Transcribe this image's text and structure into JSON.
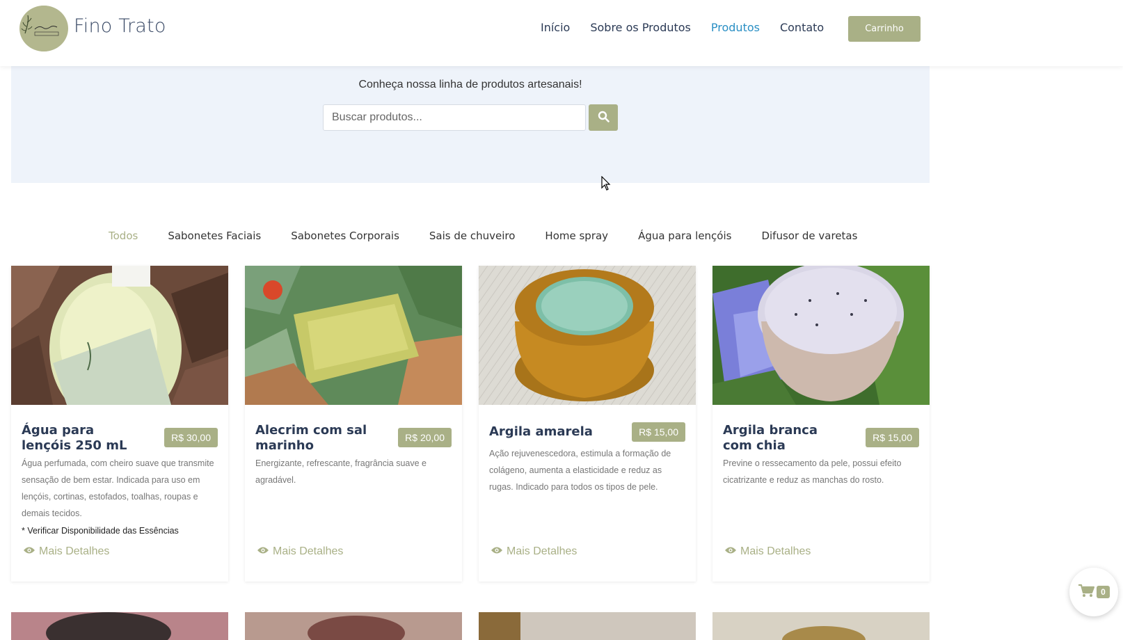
{
  "header": {
    "brand": "Fino Trato",
    "nav": [
      "Início",
      "Sobre os Produtos",
      "Produtos",
      "Contato"
    ],
    "active_nav": "Produtos",
    "cart_label": "Carrinho"
  },
  "hero": {
    "text": "Conheça nossa linha de produtos artesanais!",
    "search_placeholder": "Buscar produtos..."
  },
  "categories": [
    "Todos",
    "Sabonetes Faciais",
    "Sabonetes Corporais",
    "Sais de chuveiro",
    "Home spray",
    "Água para lençóis",
    "Difusor de varetas"
  ],
  "active_category": "Todos",
  "products": [
    {
      "title": "Água para lençóis 250 mL",
      "price": "R$ 30,00",
      "description": "Água perfumada, com cheiro suave que transmite sensação de bem estar. Indicada para uso em lençóis, cortinas, estofados, toalhas, roupas e demais tecidos.",
      "note": "* Verificar Disponibilidade das Essências",
      "more": "Mais Detalhes"
    },
    {
      "title": "Alecrim com sal marinho",
      "price": "R$ 20,00",
      "description": "Energizante, refrescante, fragrância suave e agradável.",
      "more": "Mais Detalhes"
    },
    {
      "title": "Argila amarela",
      "price": "R$ 15,00",
      "description": "Ação rejuvenescedora, estimula a formação de colágeno, aumenta a elasticidade e reduz as rugas. Indicado para todos os tipos de pele.",
      "more": "Mais Detalhes"
    },
    {
      "title": "Argila branca com chia",
      "price": "R$ 15,00",
      "description": "Previne o ressecamento da pele, possui efeito cicatrizante e reduz as manchas do rosto.",
      "more": "Mais Detalhes"
    }
  ],
  "floating_cart": {
    "count": "0"
  },
  "colors": {
    "accent": "#a9b086",
    "nav_active": "#2a8fc4",
    "title": "#2b3a55",
    "hero_bg": "#eef3fa"
  }
}
